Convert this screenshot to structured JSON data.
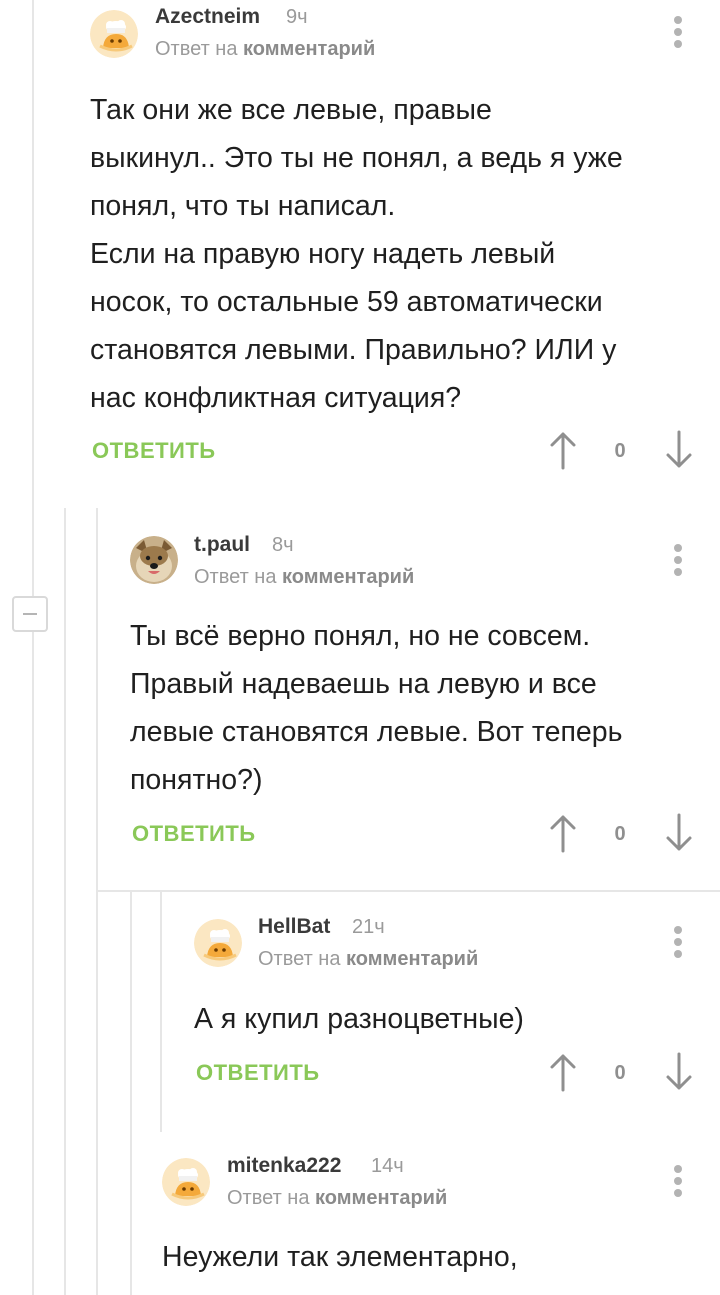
{
  "comments": [
    {
      "author": "Azectneim",
      "time": "9ч",
      "reply_prefix": "Ответ на",
      "reply_target": "комментарий",
      "body": [
        "Так они же все левые, правые",
        "выкинул.. Это ты не понял, а ведь я уже",
        "понял, что ты написал.",
        "Если на правую ногу надеть левый",
        "носок, то остальные 59 автоматически",
        "становятся левыми. Правильно? ИЛИ у",
        "нас конфликтная ситуация?"
      ],
      "reply_label": "ОТВЕТИТЬ",
      "rating": "0",
      "avatar": "default-chef-avatar"
    },
    {
      "author": "t.paul",
      "time": "8ч",
      "reply_prefix": "Ответ на",
      "reply_target": "комментарий",
      "body": [
        "Ты всё верно понял, но не совсем.",
        "Правый надеваешь на левую и все",
        "левые становятся левые. Вот теперь",
        "понятно?)"
      ],
      "reply_label": "ОТВЕТИТЬ",
      "rating": "0",
      "avatar": "dog-photo-avatar"
    },
    {
      "author": "HellBat",
      "time": "21ч",
      "reply_prefix": "Ответ на",
      "reply_target": "комментарий",
      "body": [
        "А я купил разноцветные)"
      ],
      "reply_label": "ОТВЕТИТЬ",
      "rating": "0",
      "avatar": "default-chef-avatar"
    },
    {
      "author": "mitenka222",
      "time": "14ч",
      "reply_prefix": "Ответ на",
      "reply_target": "комментарий",
      "body": [
        "Неужели так элементарно,"
      ],
      "avatar": "default-chef-avatar"
    }
  ],
  "colors": {
    "reply_green": "#8ac858",
    "muted_text": "#9a9a9a",
    "thread_line": "#e6e6e6"
  }
}
